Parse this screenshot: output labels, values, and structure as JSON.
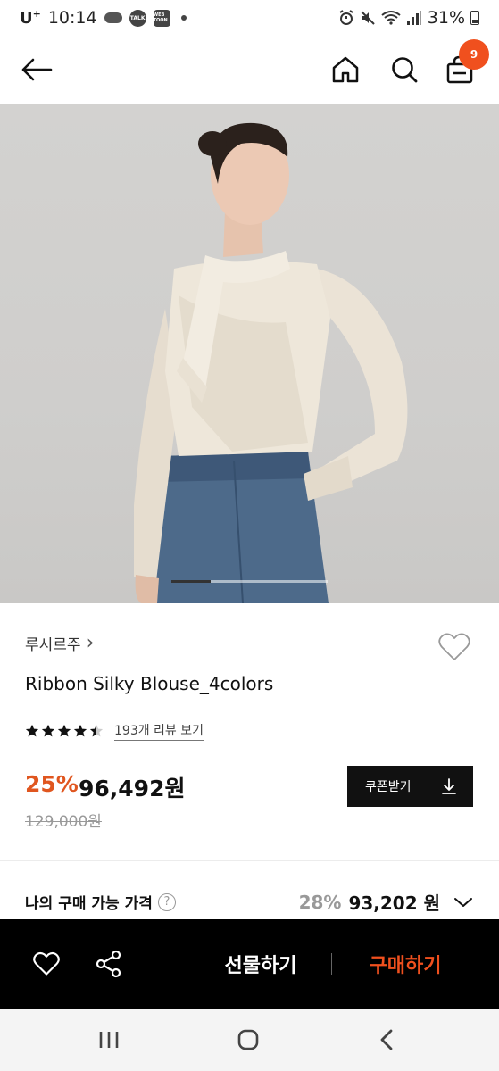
{
  "status_bar": {
    "carrier": "U",
    "carrier_sup": "+",
    "time": "10:14",
    "icon_labels": [
      "TALK",
      "WEB TOON"
    ],
    "battery": "31%"
  },
  "nav": {
    "cart_count": "9"
  },
  "gallery": {
    "progress": 0.25
  },
  "product": {
    "brand": "루시르주",
    "brand_chevron": "›",
    "name": "Ribbon Silky Blouse_4colors",
    "rating": 4.5,
    "review_link": "193개 리뷰 보기",
    "discount_rate": "25%",
    "price": "96,492원",
    "original_price": "129,000원",
    "coupon_button": "쿠폰받기"
  },
  "my_price": {
    "label": "나의 구매 가능 가격",
    "help": "?",
    "discount_rate": "28%",
    "price": "93,202 원"
  },
  "bottom_bar": {
    "gift_label": "선물하기",
    "buy_label": "구매하기"
  },
  "colors": {
    "accent": "#f0501e",
    "discount": "#e0561f",
    "bar_bg": "#000000"
  },
  "icons": [
    "back-arrow-icon",
    "home-icon",
    "search-icon",
    "shopping-bag-icon",
    "heart-icon",
    "star-icon",
    "download-icon",
    "help-icon",
    "chevron-down-icon",
    "share-icon",
    "recent-apps-icon",
    "android-home-icon",
    "android-back-icon"
  ]
}
